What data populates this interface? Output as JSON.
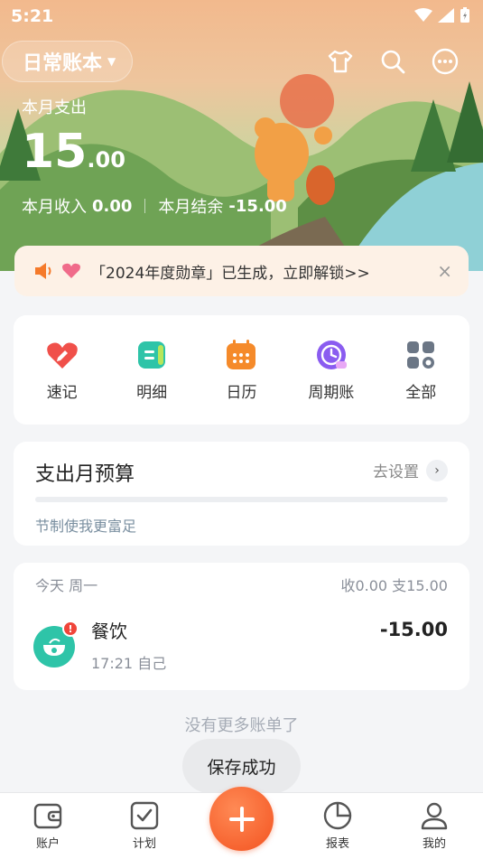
{
  "status_bar": {
    "time": "5:21"
  },
  "header": {
    "book_name": "日常账本",
    "icons": [
      "shirt-icon",
      "search-icon",
      "more-icon"
    ]
  },
  "summary": {
    "month_expense_label": "本月支出",
    "month_expense_int": "15",
    "month_expense_dec": ".00",
    "month_income_label": "本月收入",
    "month_income_value": "0.00",
    "month_balance_label": "本月结余",
    "month_balance_value": "-15.00"
  },
  "notice": {
    "text": "「2024年度勋章」已生成，立即解锁>>",
    "close": "×"
  },
  "quick_actions": [
    {
      "label": "速记",
      "icon": "quick-note-icon",
      "color": "#f0504a"
    },
    {
      "label": "明细",
      "icon": "details-icon",
      "color": "#2ec4a8"
    },
    {
      "label": "日历",
      "icon": "calendar-icon",
      "color": "#f58a2a"
    },
    {
      "label": "周期账",
      "icon": "recurring-icon",
      "color": "#8a5cf0"
    },
    {
      "label": "全部",
      "icon": "all-grid-icon",
      "color": "#6b7685"
    }
  ],
  "budget": {
    "title": "支出月预算",
    "set_label": "去设置",
    "hint": "节制使我更富足",
    "progress": 0
  },
  "records": {
    "date_label": "今天  周一",
    "day_summary": "收0.00  支15.00",
    "items": [
      {
        "category": "餐饮",
        "meta": "17:21  自己",
        "amount": "-15.00",
        "badge": "!"
      }
    ]
  },
  "no_more_text": "没有更多账单了",
  "toast": "保存成功",
  "bottom_nav": [
    {
      "label": "账户",
      "icon": "wallet-icon"
    },
    {
      "label": "计划",
      "icon": "checklist-icon"
    },
    {
      "label": "报表",
      "icon": "pie-chart-icon"
    },
    {
      "label": "我的",
      "icon": "profile-icon"
    }
  ],
  "fab": {
    "icon": "plus-icon",
    "color": "#f35320"
  }
}
